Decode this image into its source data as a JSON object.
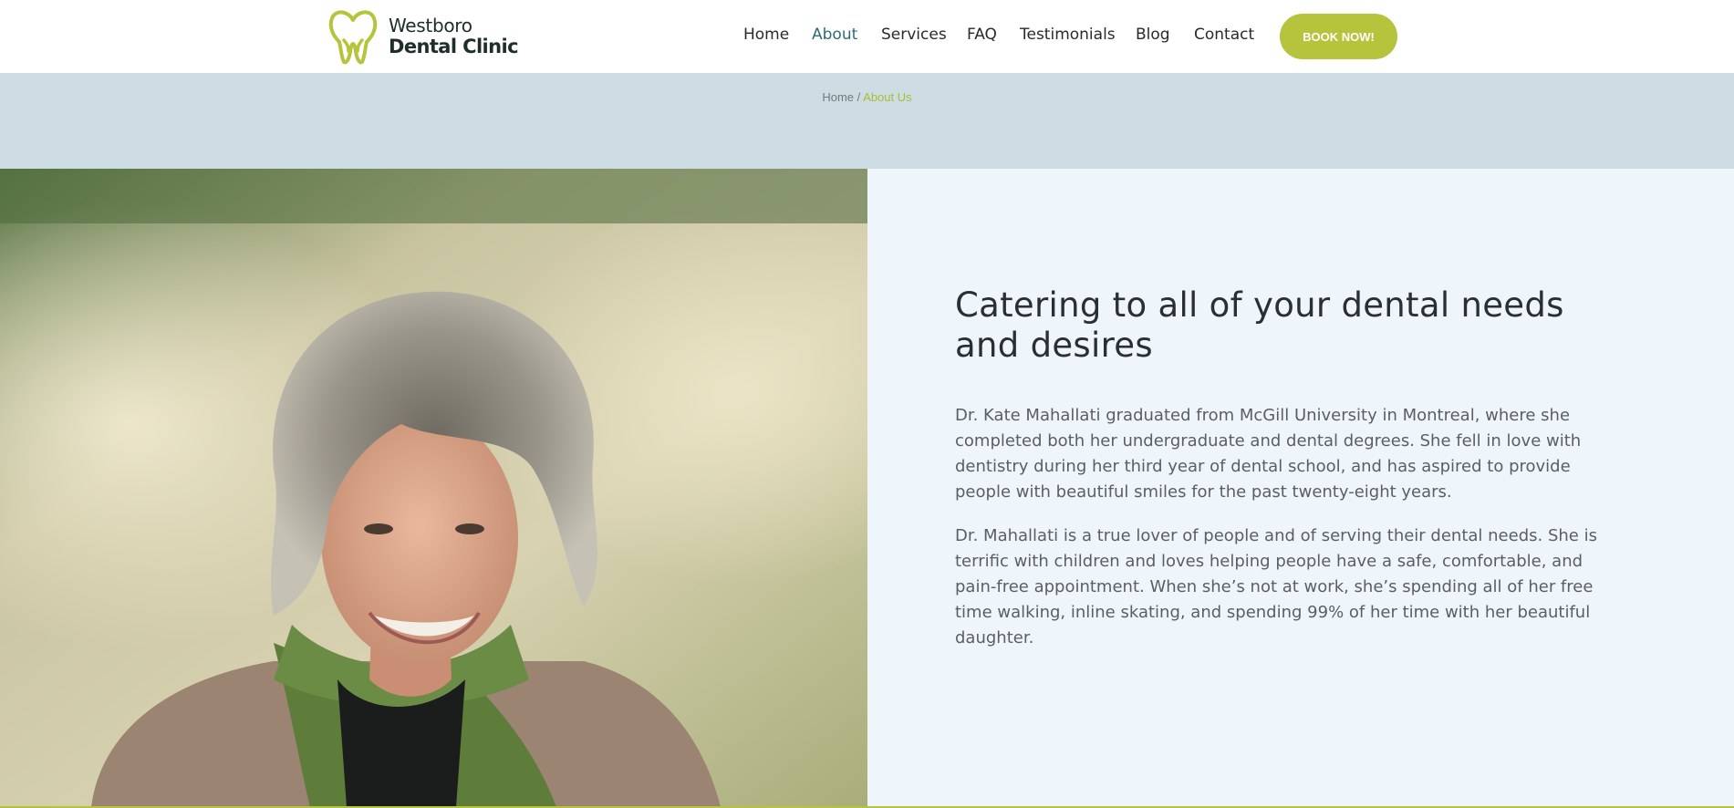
{
  "brand": {
    "name_line1": "Westboro",
    "name_line2": "Dental Clinic",
    "accent_color": "#b5c43c",
    "logo_icon": "tooth-heart-icon"
  },
  "nav": {
    "items": [
      {
        "label": "Home",
        "active": false
      },
      {
        "label": "About",
        "active": true
      },
      {
        "label": "Services",
        "active": false
      },
      {
        "label": "FAQ",
        "active": false
      },
      {
        "label": "Testimonials",
        "active": false
      },
      {
        "label": "Blog",
        "active": false
      },
      {
        "label": "Contact",
        "active": false
      }
    ],
    "active_color": "#2e6b77",
    "cta_label": "BOOK NOW!"
  },
  "breadcrumb": {
    "home": "Home",
    "separator": " / ",
    "current": "About Us"
  },
  "about": {
    "heading": "Catering to all of your dental needs and desires",
    "paragraphs": [
      "Dr. Kate Mahallati graduated from McGill University in Montreal, where she completed both her undergraduate and dental degrees. She fell in love with dentistry during her third year of dental school, and has aspired to provide people with beautiful smiles for the past twenty-eight years.",
      "Dr. Mahallati is a true lover of people and of serving their dental needs. She is terrific with children and loves helping people have a safe, comfortable, and pain-free appointment. When she’s not at work, she’s spending all of her free time walking, inline skating, and spending 99% of her time with her beautiful daughter."
    ],
    "photo_subject": "portrait of smiling woman with grey hair and green scarf"
  }
}
